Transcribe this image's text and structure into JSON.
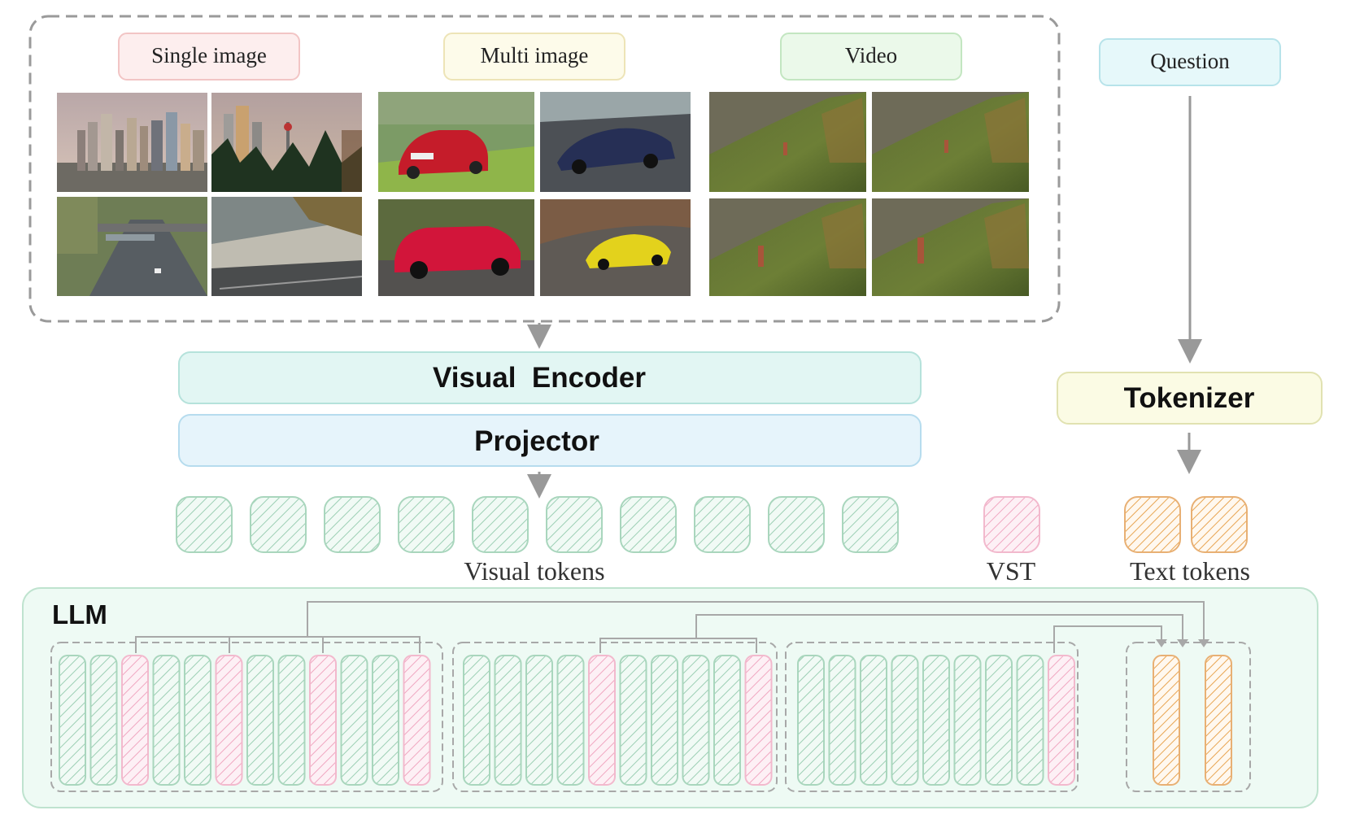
{
  "input_panel": {
    "single_label": "Single image",
    "multi_label": "Multi image",
    "video_label": "Video"
  },
  "question_label": "Question",
  "visual_encoder_label": "Visual  Encoder",
  "projector_label": "Projector",
  "tokenizer_label": "Tokenizer",
  "visual_tokens_label": "Visual tokens",
  "vst_label": "VST",
  "text_tokens_label": "Text tokens",
  "llm_label": "LLM",
  "photos": {
    "single": [
      "city-skyline-photo",
      "city-skyline-trees-photo",
      "highway-photo",
      "railway-photo"
    ],
    "multi": [
      "red-sedan-photo",
      "blue-supercar-photo",
      "red-suv-photo",
      "yellow-supercar-photo"
    ],
    "video": [
      "video-frame-1",
      "video-frame-2",
      "video-frame-3",
      "video-frame-4"
    ]
  },
  "llm_tokens": {
    "group1": [
      "v",
      "v",
      "s",
      "v",
      "v",
      "s",
      "v",
      "v",
      "s",
      "v",
      "v",
      "s"
    ],
    "group2": [
      "v",
      "v",
      "v",
      "v",
      "s",
      "v",
      "v",
      "v",
      "v",
      "s"
    ],
    "group3": [
      "v",
      "v",
      "v",
      "v",
      "v",
      "v",
      "v",
      "v",
      "s"
    ],
    "group4": [
      "t",
      "t"
    ]
  },
  "colors": {
    "visual_token": "#9ccfb4",
    "vst_token": "#f0a7c1",
    "text_token": "#e8a552",
    "encoder_fill": "#e2f6f3",
    "projector_fill": "#e6f4fb",
    "tokenizer_fill": "#fbfbe4",
    "llm_fill": "#eefaf4"
  }
}
